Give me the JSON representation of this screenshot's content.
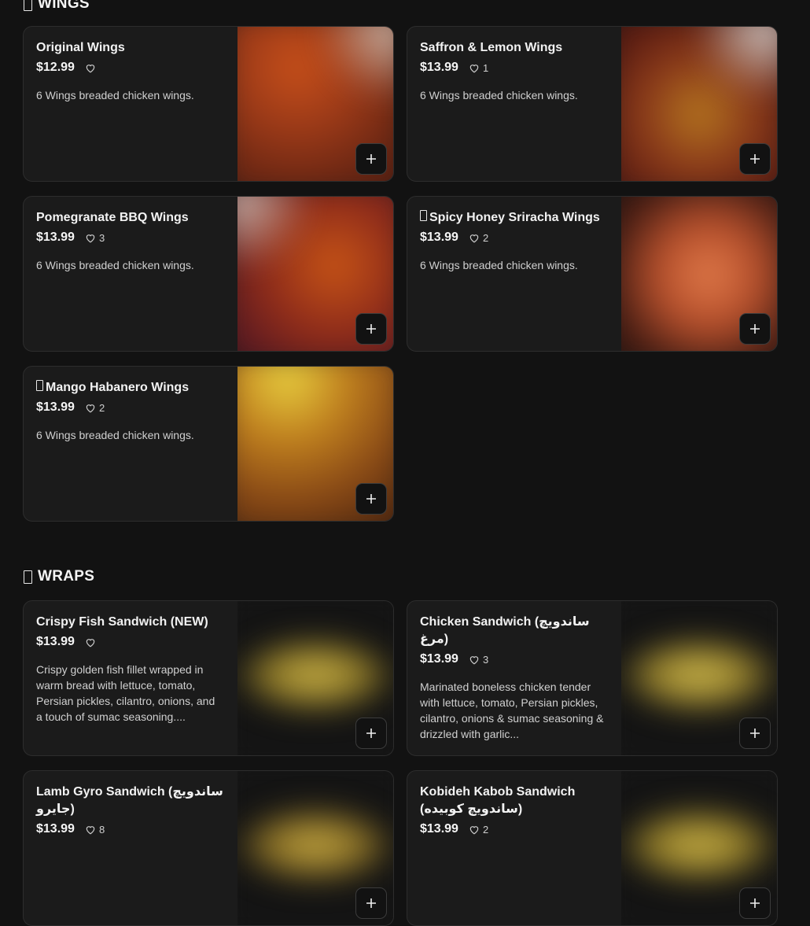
{
  "sections": [
    {
      "title": "WINGS",
      "items": [
        {
          "name": "Original Wings",
          "price": "$12.99",
          "likes": "",
          "desc": "6 Wings breaded chicken wings.",
          "emoji": false
        },
        {
          "name": "Saffron & Lemon Wings",
          "price": "$13.99",
          "likes": "1",
          "desc": "6 Wings breaded chicken wings.",
          "emoji": false
        },
        {
          "name": "Pomegranate BBQ Wings",
          "price": "$13.99",
          "likes": "3",
          "desc": "6 Wings breaded chicken wings.",
          "emoji": false
        },
        {
          "name": "Spicy Honey Sriracha Wings",
          "price": "$13.99",
          "likes": "2",
          "desc": "6 Wings breaded chicken wings.",
          "emoji": true
        },
        {
          "name": "Mango Habanero Wings",
          "price": "$13.99",
          "likes": "2",
          "desc": "6 Wings breaded chicken wings.",
          "emoji": true
        }
      ]
    },
    {
      "title": "WRAPS",
      "items": [
        {
          "name": "Crispy Fish Sandwich (NEW)",
          "price": "$13.99",
          "likes": "",
          "desc": "Crispy golden fish fillet wrapped in warm bread with lettuce, tomato, Persian pickles, cilantro, onions, and a touch of sumac seasoning....",
          "emoji": false
        },
        {
          "name": "Chicken Sandwich (ساندویچ مرغ)",
          "price": "$13.99",
          "likes": "3",
          "desc": "Marinated boneless chicken tender with lettuce, tomato, Persian pickles, cilantro, onions & sumac seasoning & drizzled with garlic...",
          "emoji": false
        },
        {
          "name": "Lamb Gyro Sandwich (ساندویچ جایرو)",
          "price": "$13.99",
          "likes": "8",
          "desc": "",
          "emoji": false
        },
        {
          "name": "Kobideh Kabob Sandwich (ساندویچ کوبیده)",
          "price": "$13.99",
          "likes": "2",
          "desc": "",
          "emoji": false
        }
      ]
    }
  ],
  "icons": {
    "heart": "heart-icon",
    "add": "plus-icon"
  },
  "colors": {
    "background": "#121212",
    "card": "#1b1b1b",
    "border": "#2d2d2d"
  }
}
